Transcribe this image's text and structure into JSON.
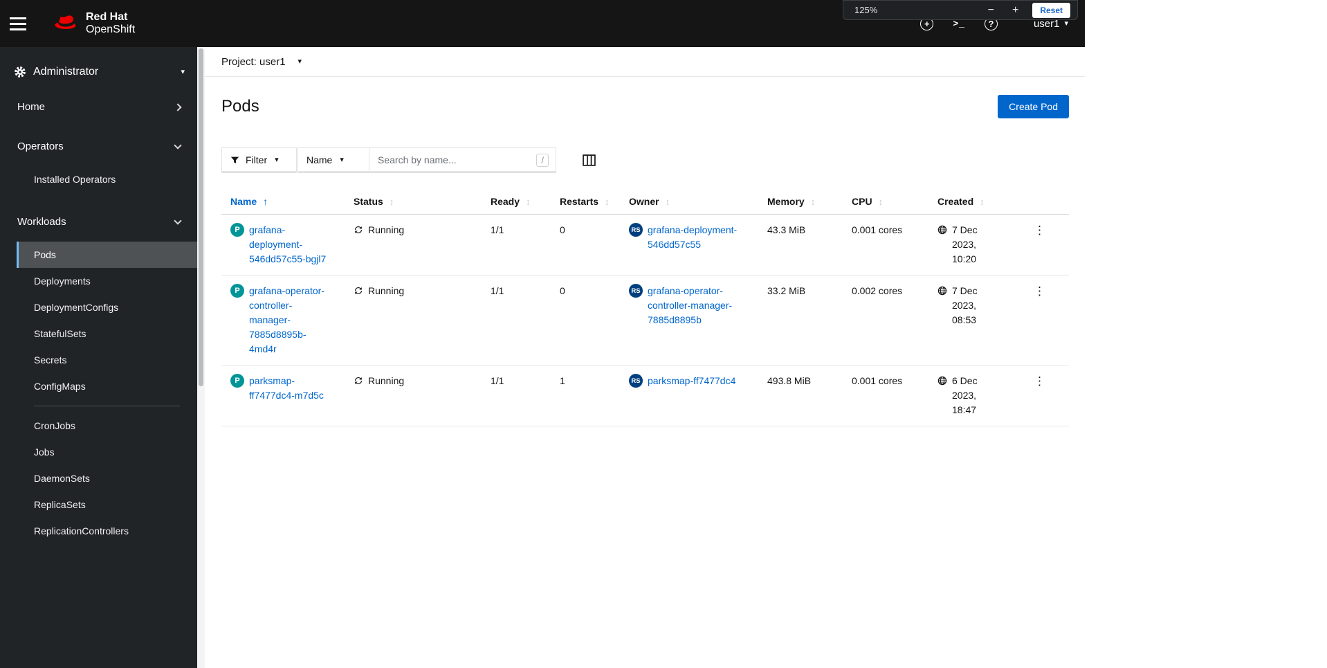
{
  "colors": {
    "accent": "#0066cc",
    "masthead_bg": "#151515",
    "sidebar_bg": "#212427",
    "nav_active_bg": "#4f5255",
    "nav_active_border": "#73bcf7",
    "link": "#0066cc",
    "badge_pod": "#009596",
    "badge_replicaset": "#004080",
    "brand_red": "#ee0000"
  },
  "glyphs": {
    "caret_down": "▾",
    "sort_asc": "↑",
    "sort_inactive": "↕",
    "kebab": "⋮",
    "terminal": ">_",
    "help": "?",
    "plus": "+",
    "minus": "−"
  },
  "masthead": {
    "brand_line1": "Red Hat",
    "brand_line2": "OpenShift",
    "user": "user1"
  },
  "zoom_overlay": {
    "level": "125%",
    "reset": "Reset"
  },
  "sidebar": {
    "perspective": "Administrator",
    "home": "Home",
    "operators": "Operators",
    "operators_items": [
      "Installed Operators"
    ],
    "workloads": "Workloads",
    "workloads_items": [
      "Pods",
      "Deployments",
      "DeploymentConfigs",
      "StatefulSets",
      "Secrets",
      "ConfigMaps",
      "CronJobs",
      "Jobs",
      "DaemonSets",
      "ReplicaSets",
      "ReplicationControllers"
    ]
  },
  "page": {
    "project": "Project: user1",
    "title": "Pods",
    "create_button": "Create Pod"
  },
  "toolbar": {
    "filter": "Filter",
    "name_select": "Name",
    "search_placeholder": "Search by name...",
    "search_shortcut": "/"
  },
  "table": {
    "columns": [
      "Name",
      "Status",
      "Ready",
      "Restarts",
      "Owner",
      "Memory",
      "CPU",
      "Created"
    ],
    "badges": {
      "pod": "P",
      "replicaset": "RS"
    },
    "rows": [
      {
        "name": "grafana-deployment-546dd57c55-bgjl7",
        "status": "Running",
        "ready": "1/1",
        "restarts": "0",
        "owner": "grafana-deployment-546dd57c55",
        "memory": "43.3 MiB",
        "cpu": "0.001 cores",
        "created": "7 Dec 2023, 10:20"
      },
      {
        "name": "grafana-operator-controller-manager-7885d8895b-4md4r",
        "status": "Running",
        "ready": "1/1",
        "restarts": "0",
        "owner": "grafana-operator-controller-manager-7885d8895b",
        "memory": "33.2 MiB",
        "cpu": "0.002 cores",
        "created": "7 Dec 2023, 08:53"
      },
      {
        "name": "parksmap-ff7477dc4-m7d5c",
        "status": "Running",
        "ready": "1/1",
        "restarts": "1",
        "owner": "parksmap-ff7477dc4",
        "memory": "493.8 MiB",
        "cpu": "0.001 cores",
        "created": "6 Dec 2023, 18:47"
      }
    ]
  }
}
